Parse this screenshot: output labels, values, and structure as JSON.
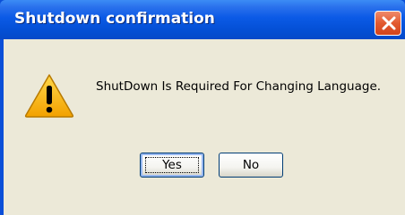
{
  "window": {
    "title": "Shutdown confirmation",
    "close_icon": "close-icon"
  },
  "dialog": {
    "icon": "warning-icon",
    "message": "ShutDown Is Required For Changing Language.",
    "buttons": {
      "yes_label": "Yes",
      "no_label": "No"
    }
  },
  "colors": {
    "titlebar": "#0450d6",
    "close_button": "#e25a30",
    "client_background": "#ece9d8",
    "warning_fill": "#f7b500"
  }
}
